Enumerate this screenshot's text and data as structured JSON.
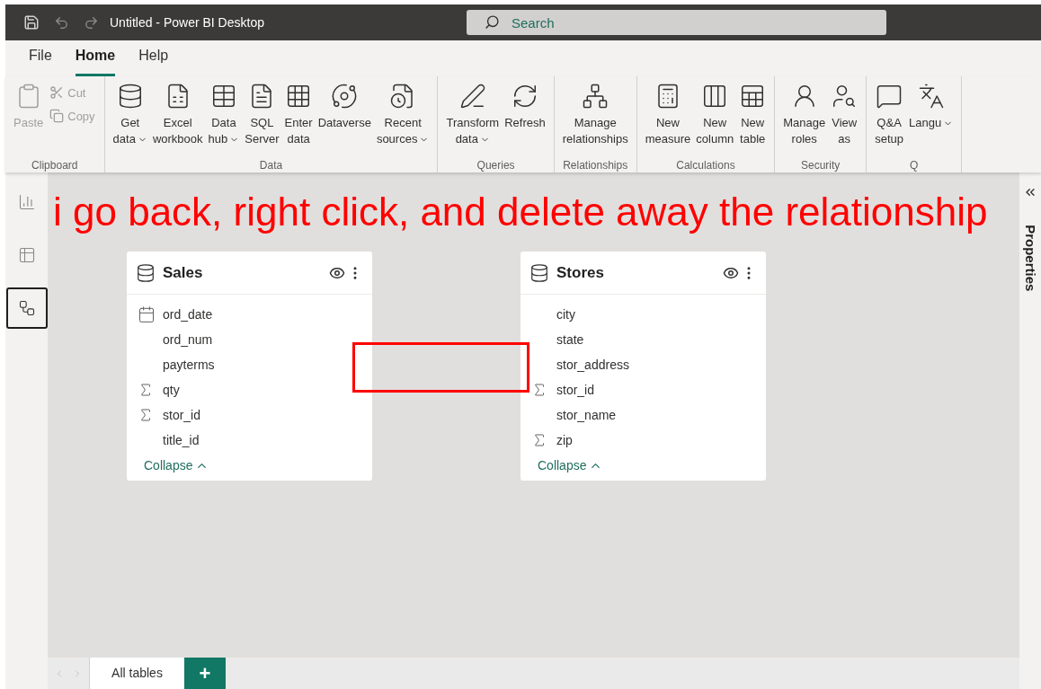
{
  "title_bar": {
    "title": "Untitled - Power BI Desktop",
    "search": {
      "placeholder": "Search"
    }
  },
  "menu": [
    {
      "label": "File",
      "selected": false
    },
    {
      "label": "Home",
      "selected": true
    },
    {
      "label": "Help",
      "selected": false
    }
  ],
  "ribbon": [
    {
      "label": "Clipboard",
      "buttons": [
        {
          "kind": "large",
          "lines": [
            "Paste"
          ],
          "disabled": true,
          "dropdown": false
        },
        {
          "kind": "small",
          "lines": [
            "Cut"
          ],
          "disabled": true,
          "dropdown": false
        },
        {
          "kind": "small",
          "lines": [
            "Copy"
          ],
          "disabled": true,
          "dropdown": false
        }
      ]
    },
    {
      "label": "Data",
      "buttons": [
        {
          "kind": "large",
          "lines": [
            "Get",
            "data"
          ],
          "disabled": false,
          "dropdown": true
        },
        {
          "kind": "large",
          "lines": [
            "Excel",
            "workbook"
          ],
          "disabled": false,
          "dropdown": false
        },
        {
          "kind": "large",
          "lines": [
            "Data",
            "hub"
          ],
          "disabled": false,
          "dropdown": true
        },
        {
          "kind": "large",
          "lines": [
            "SQL",
            "Server"
          ],
          "disabled": false,
          "dropdown": false
        },
        {
          "kind": "large",
          "lines": [
            "Enter",
            "data"
          ],
          "disabled": false,
          "dropdown": false
        },
        {
          "kind": "large",
          "lines": [
            "Dataverse"
          ],
          "disabled": false,
          "dropdown": false
        },
        {
          "kind": "large",
          "lines": [
            "Recent",
            "sources"
          ],
          "disabled": false,
          "dropdown": true
        }
      ]
    },
    {
      "label": "Queries",
      "buttons": [
        {
          "kind": "large",
          "lines": [
            "Transform",
            "data"
          ],
          "disabled": false,
          "dropdown": true
        },
        {
          "kind": "large",
          "lines": [
            "Refresh"
          ],
          "disabled": false,
          "dropdown": false
        }
      ]
    },
    {
      "label": "Relationships",
      "buttons": [
        {
          "kind": "large",
          "lines": [
            "Manage",
            "relationships"
          ],
          "disabled": false,
          "dropdown": false
        }
      ]
    },
    {
      "label": "Calculations",
      "buttons": [
        {
          "kind": "large",
          "lines": [
            "New",
            "measure"
          ],
          "disabled": false,
          "dropdown": false
        },
        {
          "kind": "large",
          "lines": [
            "New",
            "column"
          ],
          "disabled": false,
          "dropdown": false
        },
        {
          "kind": "large",
          "lines": [
            "New",
            "table"
          ],
          "disabled": false,
          "dropdown": false
        }
      ]
    },
    {
      "label": "Security",
      "buttons": [
        {
          "kind": "large",
          "lines": [
            "Manage",
            "roles"
          ],
          "disabled": false,
          "dropdown": false
        },
        {
          "kind": "large",
          "lines": [
            "View",
            "as"
          ],
          "disabled": false,
          "dropdown": false
        }
      ]
    },
    {
      "label": "Q",
      "buttons": [
        {
          "kind": "large",
          "lines": [
            "Q&A",
            "setup"
          ],
          "disabled": false,
          "dropdown": false
        },
        {
          "kind": "large",
          "lines": [
            "Langu"
          ],
          "disabled": false,
          "dropdown": true
        }
      ]
    }
  ],
  "nav": [
    {
      "selected": false
    },
    {
      "selected": false
    },
    {
      "selected": true
    }
  ],
  "annotation": "i go back, right click, and delete away the relationship",
  "tables": [
    {
      "name": "Sales",
      "fields": [
        {
          "kind": "date",
          "name": "ord_date"
        },
        {
          "kind": "text",
          "name": "ord_num"
        },
        {
          "kind": "text",
          "name": "payterms"
        },
        {
          "kind": "sum",
          "name": "qty"
        },
        {
          "kind": "sum",
          "name": "stor_id"
        },
        {
          "kind": "text",
          "name": "title_id"
        }
      ],
      "collapse": "Collapse"
    },
    {
      "name": "Stores",
      "fields": [
        {
          "kind": "text",
          "name": "city"
        },
        {
          "kind": "text",
          "name": "state"
        },
        {
          "kind": "text",
          "name": "stor_address"
        },
        {
          "kind": "sum",
          "name": "stor_id"
        },
        {
          "kind": "text",
          "name": "stor_name"
        },
        {
          "kind": "sum",
          "name": "zip"
        }
      ],
      "collapse": "Collapse"
    }
  ],
  "properties_pane": {
    "title": "Properties"
  },
  "page_tabs": [
    {
      "label": "All tables",
      "selected": true
    }
  ],
  "add_tab": "+"
}
